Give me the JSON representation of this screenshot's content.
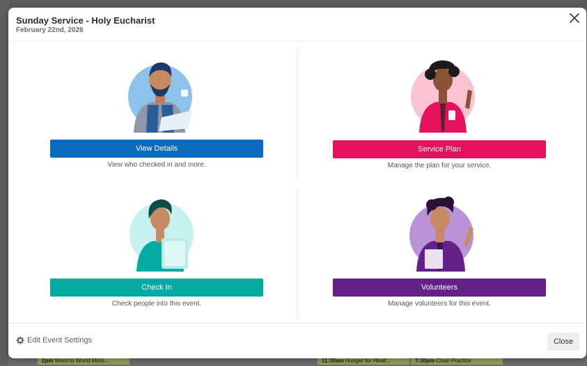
{
  "modal": {
    "title": "Sunday Service - Holy Eucharist",
    "date": "February 22nd, 2026"
  },
  "cards": {
    "view_details": {
      "button": "View Details",
      "description": "View who checked in and more.",
      "color": "#0b6cbf"
    },
    "service_plan": {
      "button": "Service Plan",
      "description": "Manage the plan for your service.",
      "color": "#e5125e"
    },
    "check_in": {
      "button": "Check In",
      "description": "Check people into this event.",
      "color": "#05aba2"
    },
    "volunteers": {
      "button": "Volunteers",
      "description": "Manage volunteers for this event.",
      "color": "#65218a"
    }
  },
  "footer": {
    "edit_settings": "Edit Event Settings",
    "close": "Close"
  },
  "background_events": [
    {
      "time": "2pm",
      "name": "Word to World Minis..."
    },
    {
      "time": "11:30am",
      "name": "Hunger for Heall..."
    },
    {
      "time": "7:30pm",
      "name": "Choir Practice"
    }
  ]
}
